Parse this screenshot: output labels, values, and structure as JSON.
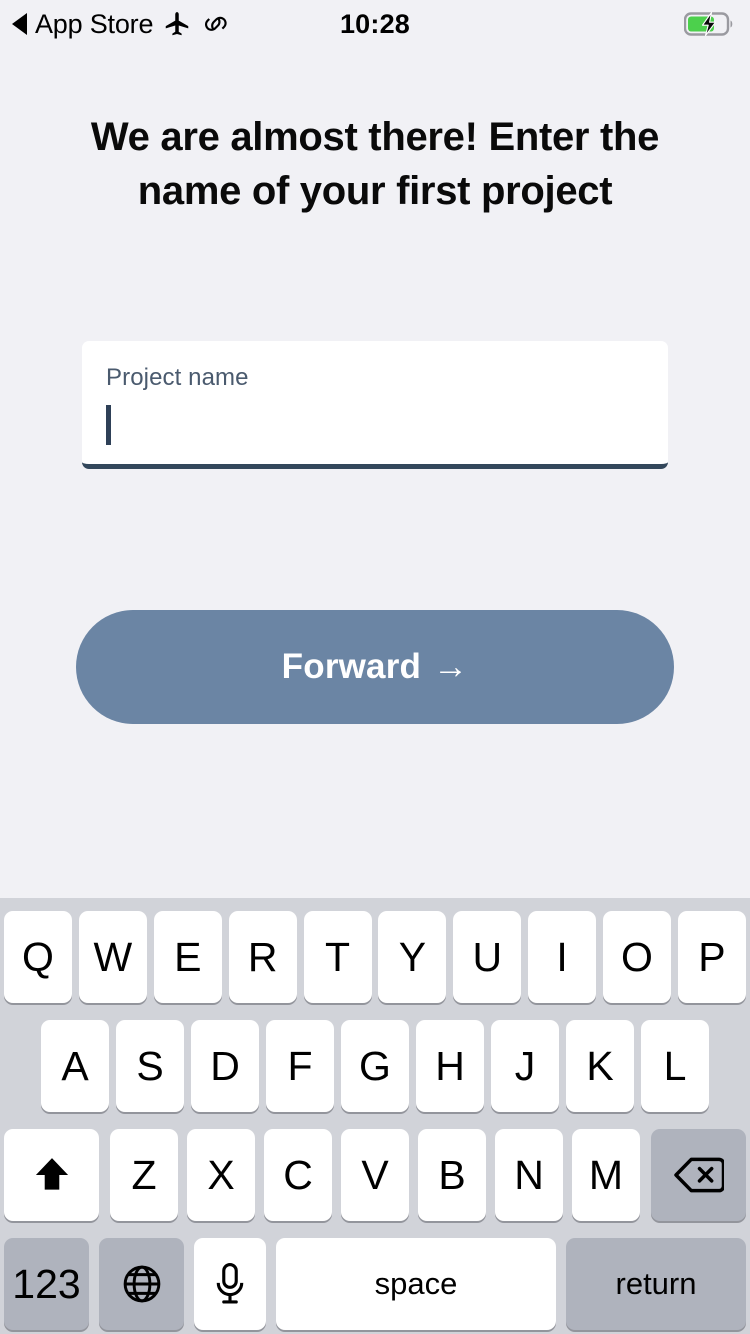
{
  "status_bar": {
    "back_label": "App Store",
    "back_icon": "back-triangle-icon",
    "airplane_icon": "airplane-mode-icon",
    "link_icon": "link-chain-icon",
    "time": "10:28",
    "battery_icon": "battery-charging-icon",
    "battery_color": "#4CD04C"
  },
  "screen": {
    "background_color": "#F1F1F5",
    "heading": "We are almost there! Enter the name of your first project"
  },
  "input_field": {
    "label": "Project name",
    "value": "",
    "placeholder": "",
    "underline_color": "#33475B",
    "background_color": "#FFFFFF",
    "caret_visible": true
  },
  "primary_action": {
    "label": "Forward",
    "arrow": "→",
    "background_color": "#6B85A4",
    "text_color": "#FFFFFF"
  },
  "keyboard": {
    "background_color": "#D1D3D9",
    "key_color": "#FFFFFF",
    "modifier_key_color": "#AFB3BD",
    "shift_state": "uppercase",
    "row1": [
      "Q",
      "W",
      "E",
      "R",
      "T",
      "Y",
      "U",
      "I",
      "O",
      "P"
    ],
    "row2": [
      "A",
      "S",
      "D",
      "F",
      "G",
      "H",
      "J",
      "K",
      "L"
    ],
    "row3_letters": [
      "Z",
      "X",
      "C",
      "V",
      "B",
      "N",
      "M"
    ],
    "shift_key": {
      "icon": "shift-arrow-up-icon",
      "label": ""
    },
    "backspace_key": {
      "icon": "backspace-delete-icon",
      "label": ""
    },
    "numbers_key": {
      "label": "123"
    },
    "globe_key": {
      "icon": "globe-language-icon",
      "label": ""
    },
    "dictation_key": {
      "icon": "microphone-icon",
      "label": ""
    },
    "space_key": {
      "label": "space"
    },
    "return_key": {
      "label": "return"
    }
  }
}
